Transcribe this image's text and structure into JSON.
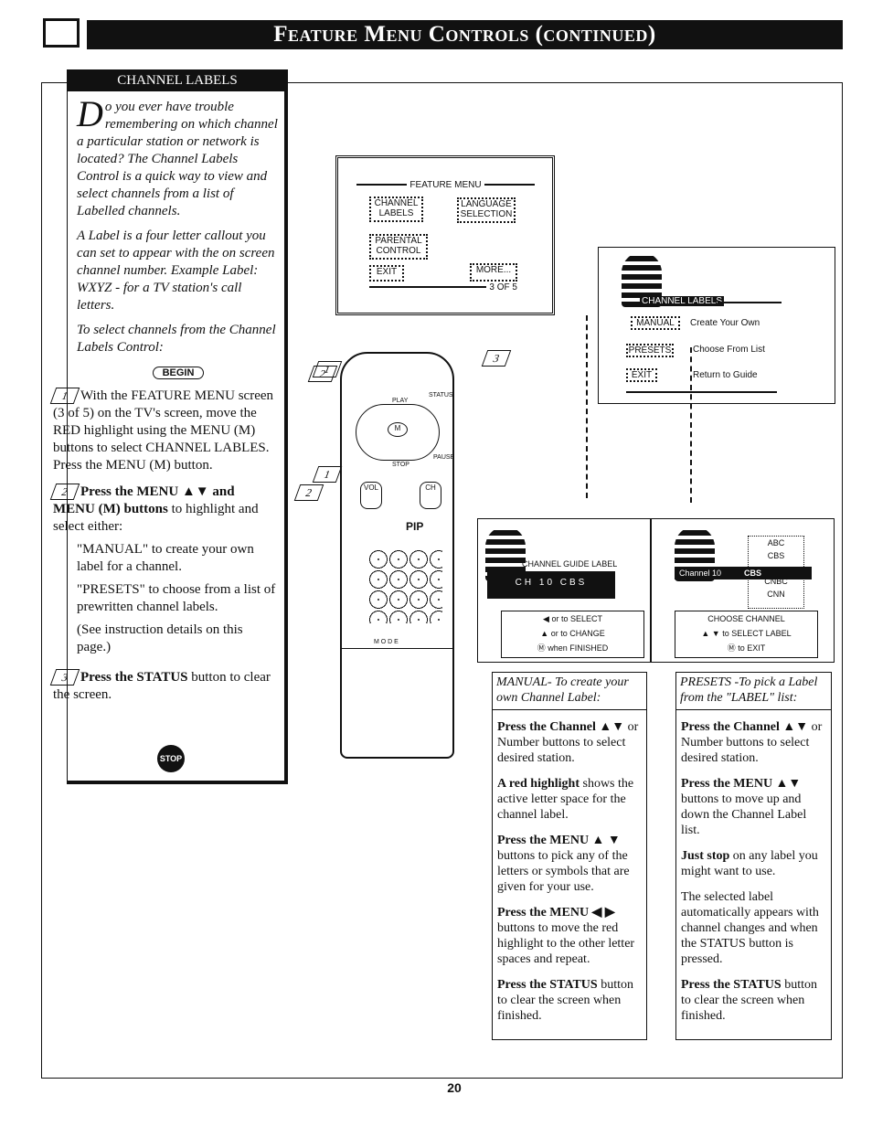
{
  "header": {
    "title": "Feature Menu Controls (continued)"
  },
  "sidebar": {
    "title": "CHANNEL LABELS",
    "intro_dropcap": "D",
    "intro": "o you ever have trouble remembering on which channel a particular station or network is located? The Channel Labels Control is a quick way to view and select channels from a list of Labelled channels.",
    "label_def": "A Label is a four letter callout you can set to appear with the on screen channel number. Example Label: WXYZ - for a TV station's call letters.",
    "to_select": "To select channels from the Channel Labels Control:",
    "begin": "BEGIN",
    "steps": [
      {
        "num": "1",
        "text": "With the FEATURE MENU screen (3 of 5) on the TV's screen, move the RED highlight using the MENU (M) buttons to select CHANNEL LABLES. Press the MENU (M) button."
      },
      {
        "num": "2",
        "bold": "Press the MENU ▲▼ and MENU (M) buttons",
        "text": " to highlight and select either:",
        "items": [
          "\"MANUAL\" to create your own label for a channel.",
          "\"PRESETS\" to choose from a list of prewritten channel labels.",
          "(See instruction details on this page.)"
        ]
      },
      {
        "num": "3",
        "bold": "Press the STATUS",
        "text": " button to clear the screen."
      }
    ],
    "stop": "STOP"
  },
  "feature_menu": {
    "title": "FEATURE MENU",
    "items": [
      "CHANNEL LABELS",
      "LANGUAGE SELECTION",
      "PARENTAL CONTROL",
      "EXIT",
      "MORE..."
    ],
    "page": "3 OF 5"
  },
  "channel_labels_menu": {
    "title": "CHANNEL LABELS",
    "options": [
      {
        "label": "MANUAL",
        "desc": "Create Your Own"
      },
      {
        "label": "PRESETS",
        "desc": "Choose From List"
      },
      {
        "label": "EXIT",
        "desc": "Return to Guide"
      }
    ]
  },
  "manual_screen": {
    "title": "CHANNEL GUIDE LABEL",
    "value": "CH 10 CBS",
    "hints": [
      "or  to SELECT",
      "or  to CHANGE",
      "when FINISHED"
    ]
  },
  "presets_screen": {
    "channel": "Channel   10",
    "label": "CBS",
    "list": [
      "ABC",
      "CBS",
      "CBS",
      "CNBC",
      "CNN"
    ],
    "hints": [
      "CHOOSE CHANNEL",
      "to SELECT LABEL",
      "to EXIT"
    ]
  },
  "remote": {
    "labels": [
      "PLAY",
      "STATUS",
      "STOP",
      "PAUSE",
      "VOL",
      "CH",
      "PIP",
      "M O D E"
    ]
  },
  "callouts": [
    "1",
    "2",
    "3",
    "1",
    "2"
  ],
  "manual_col": {
    "title": "MANUAL- To create your own Channel Label:",
    "paras": [
      {
        "b": "Press the Channel ▲▼",
        "t": " or Number buttons to select desired station."
      },
      {
        "b": "A red highlight",
        "t": " shows the active letter space for the channel label."
      },
      {
        "b": "Press the MENU ▲ ▼",
        "t": " buttons to pick any of the letters or symbols that are given for your use."
      },
      {
        "b": "Press the MENU ◀ ▶",
        "t": " buttons to move the red highlight to the other letter spaces and repeat."
      },
      {
        "b": "Press the STATUS",
        "t": " button to clear the screen when finished."
      }
    ]
  },
  "presets_col": {
    "title": "PRESETS -To pick a Label from the \"LABEL\" list:",
    "paras": [
      {
        "b": "Press the Channel ▲▼",
        "t": " or Number buttons to select desired station."
      },
      {
        "b": "Press the MENU ▲▼",
        "t": " buttons to move up and down the Channel Label list."
      },
      {
        "b": "Just stop",
        "t": " on any label you might want to use."
      },
      {
        "b": "",
        "t": "The selected label automatically appears with channel changes and when the STATUS button is pressed."
      },
      {
        "b": "Press the STATUS",
        "t": " button to clear the screen when finished."
      }
    ]
  },
  "page_number": "20"
}
